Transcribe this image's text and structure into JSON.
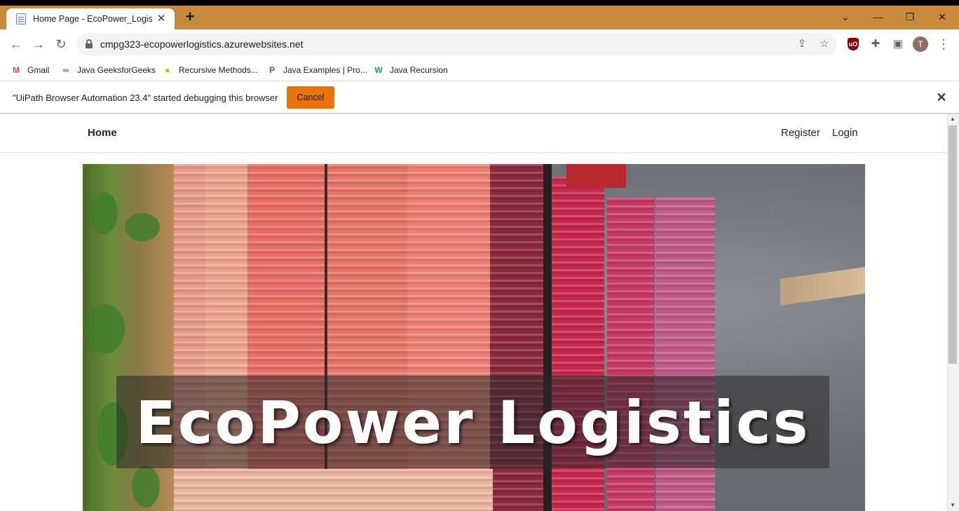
{
  "browser": {
    "tab_title": "Home Page - EcoPower_Logistic",
    "tab_close": "✕",
    "new_tab": "+",
    "window_controls": {
      "list": "⌄",
      "minimize": "—",
      "restore": "❐",
      "close": "✕"
    },
    "nav": {
      "back": "←",
      "forward": "→",
      "reload": "↻"
    },
    "url": "cmpg323-ecopowerlogistics.azurewebsites.net",
    "profile_initial": "T",
    "icons": {
      "share": "⇪",
      "star": "☆",
      "ublock": "uO",
      "extensions": "✚",
      "sidepanel": "▣",
      "menu": "⋮"
    }
  },
  "bookmarks": [
    {
      "label": "Gmail",
      "icon": "M",
      "icon_name": "gmail-icon",
      "color": "#ea4335"
    },
    {
      "label": "Java GeeksforGeeks",
      "icon": "∞",
      "icon_name": "geeksforgeeks-icon",
      "color": "#2f8d46"
    },
    {
      "label": "Recursive Methods...",
      "icon": "●",
      "icon_name": "recursive-methods-icon",
      "color": "#e0c000"
    },
    {
      "label": "Java Examples | Pro...",
      "icon": "P",
      "icon_name": "programiz-icon",
      "color": "#7b3fe4"
    },
    {
      "label": "Java Recursion",
      "icon": "W",
      "icon_name": "w3schools-icon",
      "color": "#04aa6d"
    }
  ],
  "debug_bar": {
    "message": "\"UiPath Browser Automation 23.4\" started debugging this browser",
    "cancel_label": "Cancel",
    "close": "✕",
    "accent": "#e8710a"
  },
  "site": {
    "brand": "Home",
    "nav_links": [
      "Register",
      "Login"
    ],
    "hero_title": "EcoPower Logistics"
  },
  "scrollbar": {
    "up": "▲",
    "down": "▼"
  }
}
